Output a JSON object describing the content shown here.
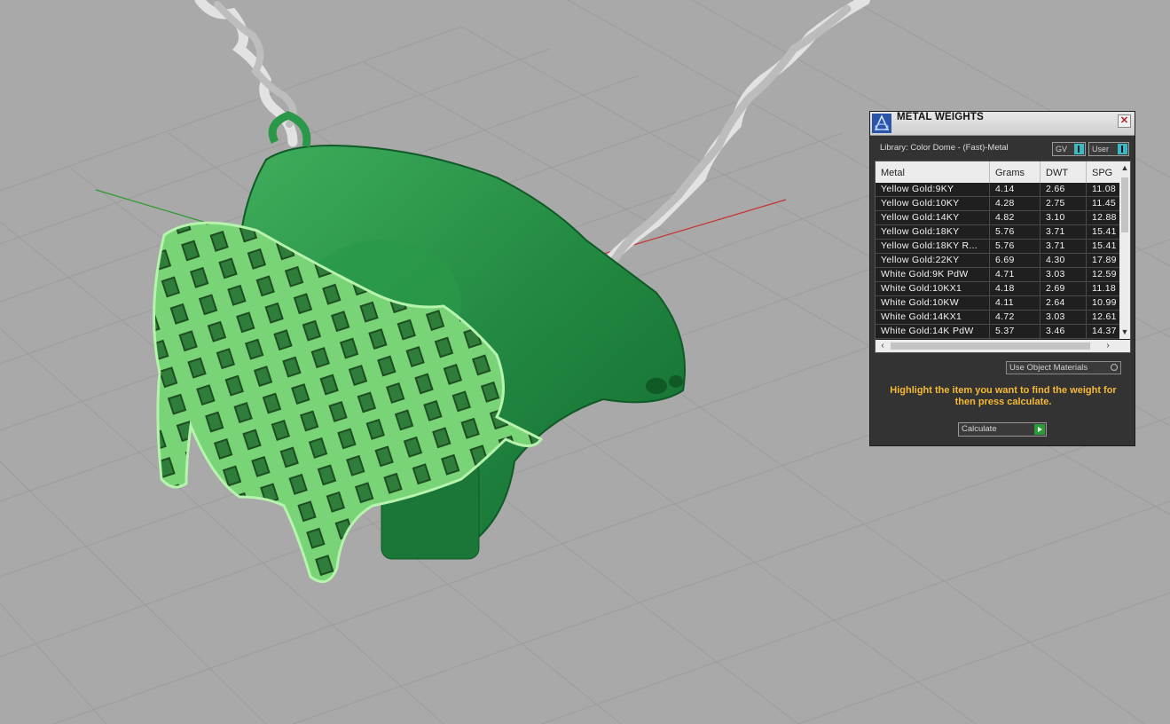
{
  "panel": {
    "title": "METAL WEIGHTS",
    "library_label": "Library: Color Dome - (Fast)-Metal",
    "gv_label": "GV",
    "user_label": "User",
    "columns": [
      "Metal",
      "Grams",
      "DWT",
      "SPG"
    ],
    "rows": [
      [
        "Yellow Gold:9KY",
        "4.14",
        "2.66",
        "11.08"
      ],
      [
        "Yellow Gold:10KY",
        "4.28",
        "2.75",
        "11.45"
      ],
      [
        "Yellow Gold:14KY",
        "4.82",
        "3.10",
        "12.88"
      ],
      [
        "Yellow Gold:18KY",
        "5.76",
        "3.71",
        "15.41"
      ],
      [
        "Yellow Gold:18KY R...",
        "5.76",
        "3.71",
        "15.41"
      ],
      [
        "Yellow Gold:22KY",
        "6.69",
        "4.30",
        "17.89"
      ],
      [
        "White Gold:9K PdW",
        "4.71",
        "3.03",
        "12.59"
      ],
      [
        "White Gold:10KX1",
        "4.18",
        "2.69",
        "11.18"
      ],
      [
        "White Gold:10KW",
        "4.11",
        "2.64",
        "10.99"
      ],
      [
        "White Gold:14KX1",
        "4.72",
        "3.03",
        "12.61"
      ],
      [
        "White Gold:14K PdW",
        "5.37",
        "3.46",
        "14.37"
      ]
    ],
    "use_object_materials": "Use Object Materials",
    "hint": "Highlight the item you want to find the weight for then press calculate.",
    "calculate_label": "Calculate"
  },
  "colors": {
    "viewport_bg": "#a9a9a9",
    "grid": "#999999",
    "model_green": "#2e8b48",
    "selected_green": "#6ecf6e",
    "chain": "#dcdcdc",
    "hint_text": "#f5b935"
  }
}
